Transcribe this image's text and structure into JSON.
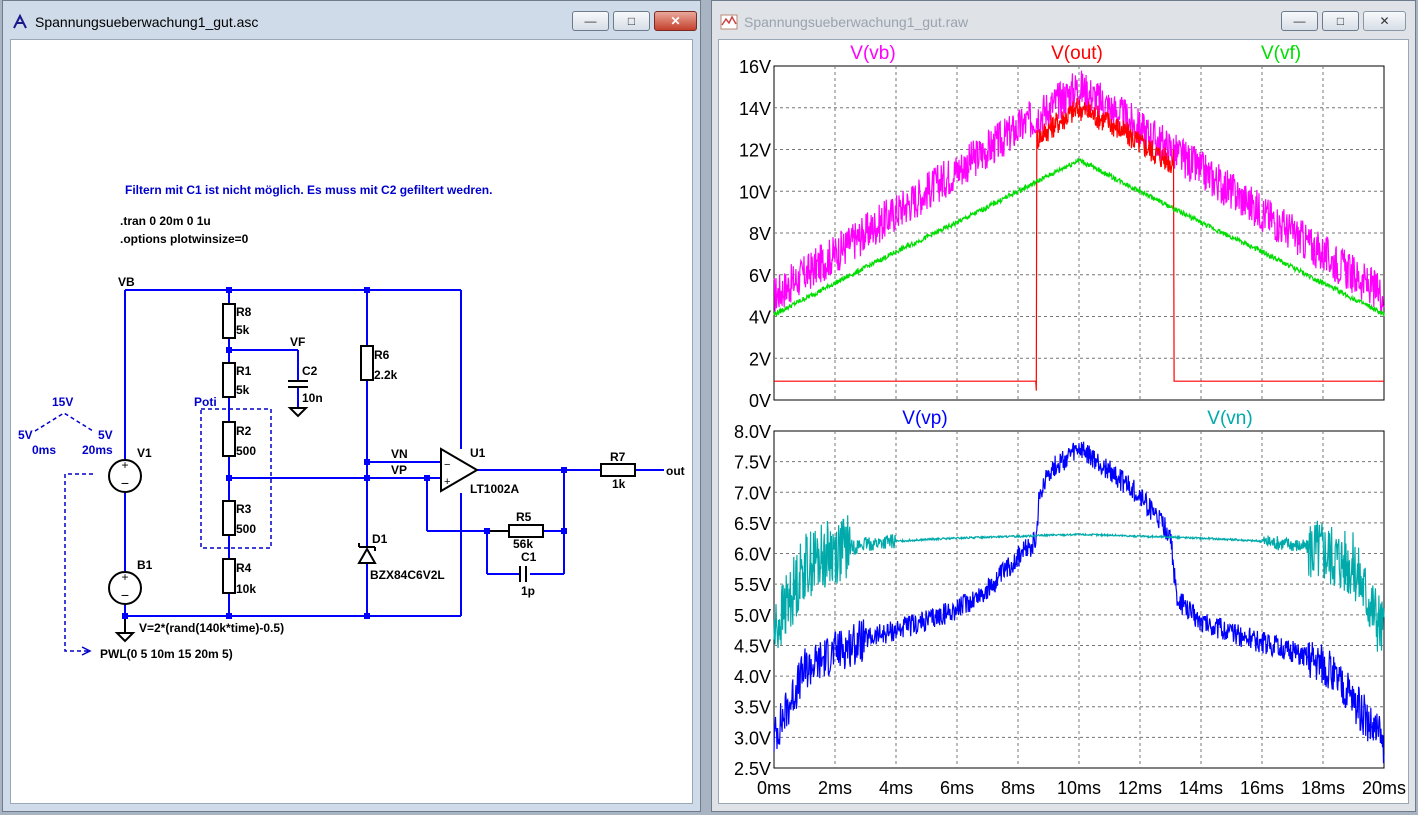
{
  "schematic_window": {
    "title": "Spannungsueberwachung1_gut.asc",
    "buttons": {
      "minimize": "—",
      "maximize": "□",
      "close": "✕"
    },
    "comment": "Filtern mit C1 ist nicht möglich. Es muss mit C2 gefiltert wedren.",
    "directives": [
      ".tran 0 20m 0 1u",
      ".options plotwinsize=0"
    ],
    "net_labels": {
      "vb": "VB",
      "vf": "VF",
      "vn": "VN",
      "vp": "VP",
      "out": "out"
    },
    "poti_label": "Poti",
    "components": [
      {
        "ref": "R8",
        "value": "5k"
      },
      {
        "ref": "R1",
        "value": "5k"
      },
      {
        "ref": "R2",
        "value": "500"
      },
      {
        "ref": "R3",
        "value": "500"
      },
      {
        "ref": "R4",
        "value": "10k"
      },
      {
        "ref": "C2",
        "value": "10n"
      },
      {
        "ref": "R6",
        "value": "2.2k"
      },
      {
        "ref": "D1",
        "value": "BZX84C6V2L"
      },
      {
        "ref": "U1",
        "value": "LT1002A"
      },
      {
        "ref": "R7",
        "value": "1k"
      },
      {
        "ref": "R5",
        "value": "56k"
      },
      {
        "ref": "C1",
        "value": "1p"
      },
      {
        "ref": "V1",
        "value": ""
      },
      {
        "ref": "B1",
        "value": ""
      }
    ],
    "b1_expression": "V=2*(rand(140k*time)-0.5)",
    "pwl_expression": "PWL(0 5 10m 15 20m 5)",
    "pwl_sketch": {
      "peak": "15V",
      "left": "5V",
      "right": "5V",
      "t0": "0ms",
      "t1": "20ms"
    }
  },
  "waveform_window": {
    "title": "Spannungsueberwachung1_gut.raw",
    "buttons": {
      "minimize": "—",
      "maximize": "□",
      "close": "✕"
    }
  },
  "chart_data": [
    {
      "type": "line",
      "x_unit": "ms",
      "xlim": [
        0,
        20
      ],
      "ylim": [
        0,
        16
      ],
      "grid": true,
      "ytick_labels": [
        "0V",
        "2V",
        "4V",
        "6V",
        "8V",
        "10V",
        "12V",
        "14V",
        "16V"
      ],
      "series": [
        {
          "name": "V(vb)",
          "color": "#ff00ff",
          "x": [
            0,
            2,
            4,
            6,
            8,
            10,
            12,
            14,
            16,
            18,
            20
          ],
          "y": [
            5,
            7,
            9,
            11,
            13,
            15,
            13,
            11,
            9,
            7,
            5
          ],
          "noise": "±1V"
        },
        {
          "name": "V(out)",
          "color": "#ff0000",
          "x": [
            0,
            8.6,
            8.6,
            9,
            10,
            11,
            12,
            13,
            13.1,
            13.1,
            20
          ],
          "y": [
            0.9,
            0.9,
            12.5,
            13,
            14,
            13.3,
            12.3,
            11.4,
            11.4,
            0.9,
            0.9
          ]
        },
        {
          "name": "V(vf)",
          "color": "#00dd00",
          "x": [
            0,
            2,
            4,
            6,
            8,
            10,
            12,
            14,
            16,
            18,
            20
          ],
          "y": [
            4.1,
            5.6,
            7.1,
            8.5,
            10,
            11.5,
            10,
            8.5,
            7.1,
            5.6,
            4.1
          ]
        }
      ]
    },
    {
      "type": "line",
      "x_unit": "ms",
      "xlim": [
        0,
        20
      ],
      "ylim": [
        2.5,
        8.0
      ],
      "grid": true,
      "xtick_labels": [
        "0ms",
        "2ms",
        "4ms",
        "6ms",
        "8ms",
        "10ms",
        "12ms",
        "14ms",
        "16ms",
        "18ms",
        "20ms"
      ],
      "ytick_labels": [
        "2.5V",
        "3.0V",
        "3.5V",
        "4.0V",
        "4.5V",
        "5.0V",
        "5.5V",
        "6.0V",
        "6.5V",
        "7.0V",
        "7.5V",
        "8.0V"
      ],
      "series": [
        {
          "name": "V(vp)",
          "color": "#0000ff",
          "x": [
            0,
            1,
            2,
            3,
            4,
            5,
            6,
            7,
            8,
            8.6,
            8.7,
            9,
            10,
            11,
            12,
            13,
            13.2,
            14,
            15,
            16,
            17,
            18,
            19,
            20
          ],
          "y": [
            3.0,
            4.1,
            4.4,
            4.6,
            4.75,
            4.9,
            5.1,
            5.4,
            5.95,
            6.2,
            6.95,
            7.35,
            7.7,
            7.35,
            6.95,
            6.3,
            5.25,
            4.9,
            4.7,
            4.55,
            4.4,
            4.2,
            3.6,
            2.9
          ]
        },
        {
          "name": "V(vn)",
          "color": "#00aaaa",
          "x": [
            0,
            1,
            2,
            3,
            4,
            5,
            6,
            7,
            8,
            9,
            10,
            11,
            12,
            13,
            14,
            15,
            16,
            17,
            18,
            19,
            20
          ],
          "y": [
            4.7,
            5.8,
            6.05,
            6.15,
            6.2,
            6.23,
            6.25,
            6.27,
            6.28,
            6.3,
            6.31,
            6.3,
            6.28,
            6.27,
            6.25,
            6.23,
            6.2,
            6.15,
            6.05,
            5.8,
            4.7
          ]
        }
      ]
    }
  ]
}
